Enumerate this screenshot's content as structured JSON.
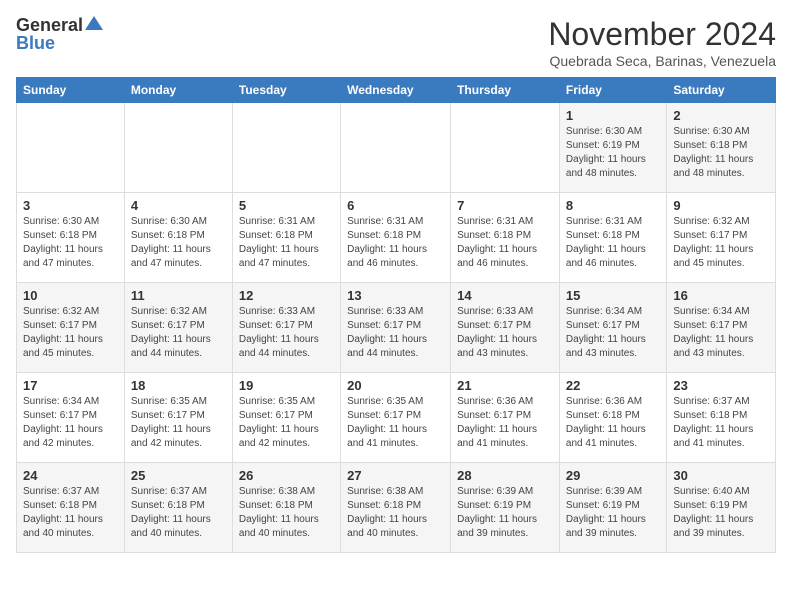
{
  "header": {
    "logo_general": "General",
    "logo_blue": "Blue",
    "month": "November 2024",
    "location": "Quebrada Seca, Barinas, Venezuela"
  },
  "weekdays": [
    "Sunday",
    "Monday",
    "Tuesday",
    "Wednesday",
    "Thursday",
    "Friday",
    "Saturday"
  ],
  "weeks": [
    [
      {
        "day": "",
        "info": ""
      },
      {
        "day": "",
        "info": ""
      },
      {
        "day": "",
        "info": ""
      },
      {
        "day": "",
        "info": ""
      },
      {
        "day": "",
        "info": ""
      },
      {
        "day": "1",
        "info": "Sunrise: 6:30 AM\nSunset: 6:19 PM\nDaylight: 11 hours\nand 48 minutes."
      },
      {
        "day": "2",
        "info": "Sunrise: 6:30 AM\nSunset: 6:18 PM\nDaylight: 11 hours\nand 48 minutes."
      }
    ],
    [
      {
        "day": "3",
        "info": "Sunrise: 6:30 AM\nSunset: 6:18 PM\nDaylight: 11 hours\nand 47 minutes."
      },
      {
        "day": "4",
        "info": "Sunrise: 6:30 AM\nSunset: 6:18 PM\nDaylight: 11 hours\nand 47 minutes."
      },
      {
        "day": "5",
        "info": "Sunrise: 6:31 AM\nSunset: 6:18 PM\nDaylight: 11 hours\nand 47 minutes."
      },
      {
        "day": "6",
        "info": "Sunrise: 6:31 AM\nSunset: 6:18 PM\nDaylight: 11 hours\nand 46 minutes."
      },
      {
        "day": "7",
        "info": "Sunrise: 6:31 AM\nSunset: 6:18 PM\nDaylight: 11 hours\nand 46 minutes."
      },
      {
        "day": "8",
        "info": "Sunrise: 6:31 AM\nSunset: 6:18 PM\nDaylight: 11 hours\nand 46 minutes."
      },
      {
        "day": "9",
        "info": "Sunrise: 6:32 AM\nSunset: 6:17 PM\nDaylight: 11 hours\nand 45 minutes."
      }
    ],
    [
      {
        "day": "10",
        "info": "Sunrise: 6:32 AM\nSunset: 6:17 PM\nDaylight: 11 hours\nand 45 minutes."
      },
      {
        "day": "11",
        "info": "Sunrise: 6:32 AM\nSunset: 6:17 PM\nDaylight: 11 hours\nand 44 minutes."
      },
      {
        "day": "12",
        "info": "Sunrise: 6:33 AM\nSunset: 6:17 PM\nDaylight: 11 hours\nand 44 minutes."
      },
      {
        "day": "13",
        "info": "Sunrise: 6:33 AM\nSunset: 6:17 PM\nDaylight: 11 hours\nand 44 minutes."
      },
      {
        "day": "14",
        "info": "Sunrise: 6:33 AM\nSunset: 6:17 PM\nDaylight: 11 hours\nand 43 minutes."
      },
      {
        "day": "15",
        "info": "Sunrise: 6:34 AM\nSunset: 6:17 PM\nDaylight: 11 hours\nand 43 minutes."
      },
      {
        "day": "16",
        "info": "Sunrise: 6:34 AM\nSunset: 6:17 PM\nDaylight: 11 hours\nand 43 minutes."
      }
    ],
    [
      {
        "day": "17",
        "info": "Sunrise: 6:34 AM\nSunset: 6:17 PM\nDaylight: 11 hours\nand 42 minutes."
      },
      {
        "day": "18",
        "info": "Sunrise: 6:35 AM\nSunset: 6:17 PM\nDaylight: 11 hours\nand 42 minutes."
      },
      {
        "day": "19",
        "info": "Sunrise: 6:35 AM\nSunset: 6:17 PM\nDaylight: 11 hours\nand 42 minutes."
      },
      {
        "day": "20",
        "info": "Sunrise: 6:35 AM\nSunset: 6:17 PM\nDaylight: 11 hours\nand 41 minutes."
      },
      {
        "day": "21",
        "info": "Sunrise: 6:36 AM\nSunset: 6:17 PM\nDaylight: 11 hours\nand 41 minutes."
      },
      {
        "day": "22",
        "info": "Sunrise: 6:36 AM\nSunset: 6:18 PM\nDaylight: 11 hours\nand 41 minutes."
      },
      {
        "day": "23",
        "info": "Sunrise: 6:37 AM\nSunset: 6:18 PM\nDaylight: 11 hours\nand 41 minutes."
      }
    ],
    [
      {
        "day": "24",
        "info": "Sunrise: 6:37 AM\nSunset: 6:18 PM\nDaylight: 11 hours\nand 40 minutes."
      },
      {
        "day": "25",
        "info": "Sunrise: 6:37 AM\nSunset: 6:18 PM\nDaylight: 11 hours\nand 40 minutes."
      },
      {
        "day": "26",
        "info": "Sunrise: 6:38 AM\nSunset: 6:18 PM\nDaylight: 11 hours\nand 40 minutes."
      },
      {
        "day": "27",
        "info": "Sunrise: 6:38 AM\nSunset: 6:18 PM\nDaylight: 11 hours\nand 40 minutes."
      },
      {
        "day": "28",
        "info": "Sunrise: 6:39 AM\nSunset: 6:19 PM\nDaylight: 11 hours\nand 39 minutes."
      },
      {
        "day": "29",
        "info": "Sunrise: 6:39 AM\nSunset: 6:19 PM\nDaylight: 11 hours\nand 39 minutes."
      },
      {
        "day": "30",
        "info": "Sunrise: 6:40 AM\nSunset: 6:19 PM\nDaylight: 11 hours\nand 39 minutes."
      }
    ]
  ]
}
